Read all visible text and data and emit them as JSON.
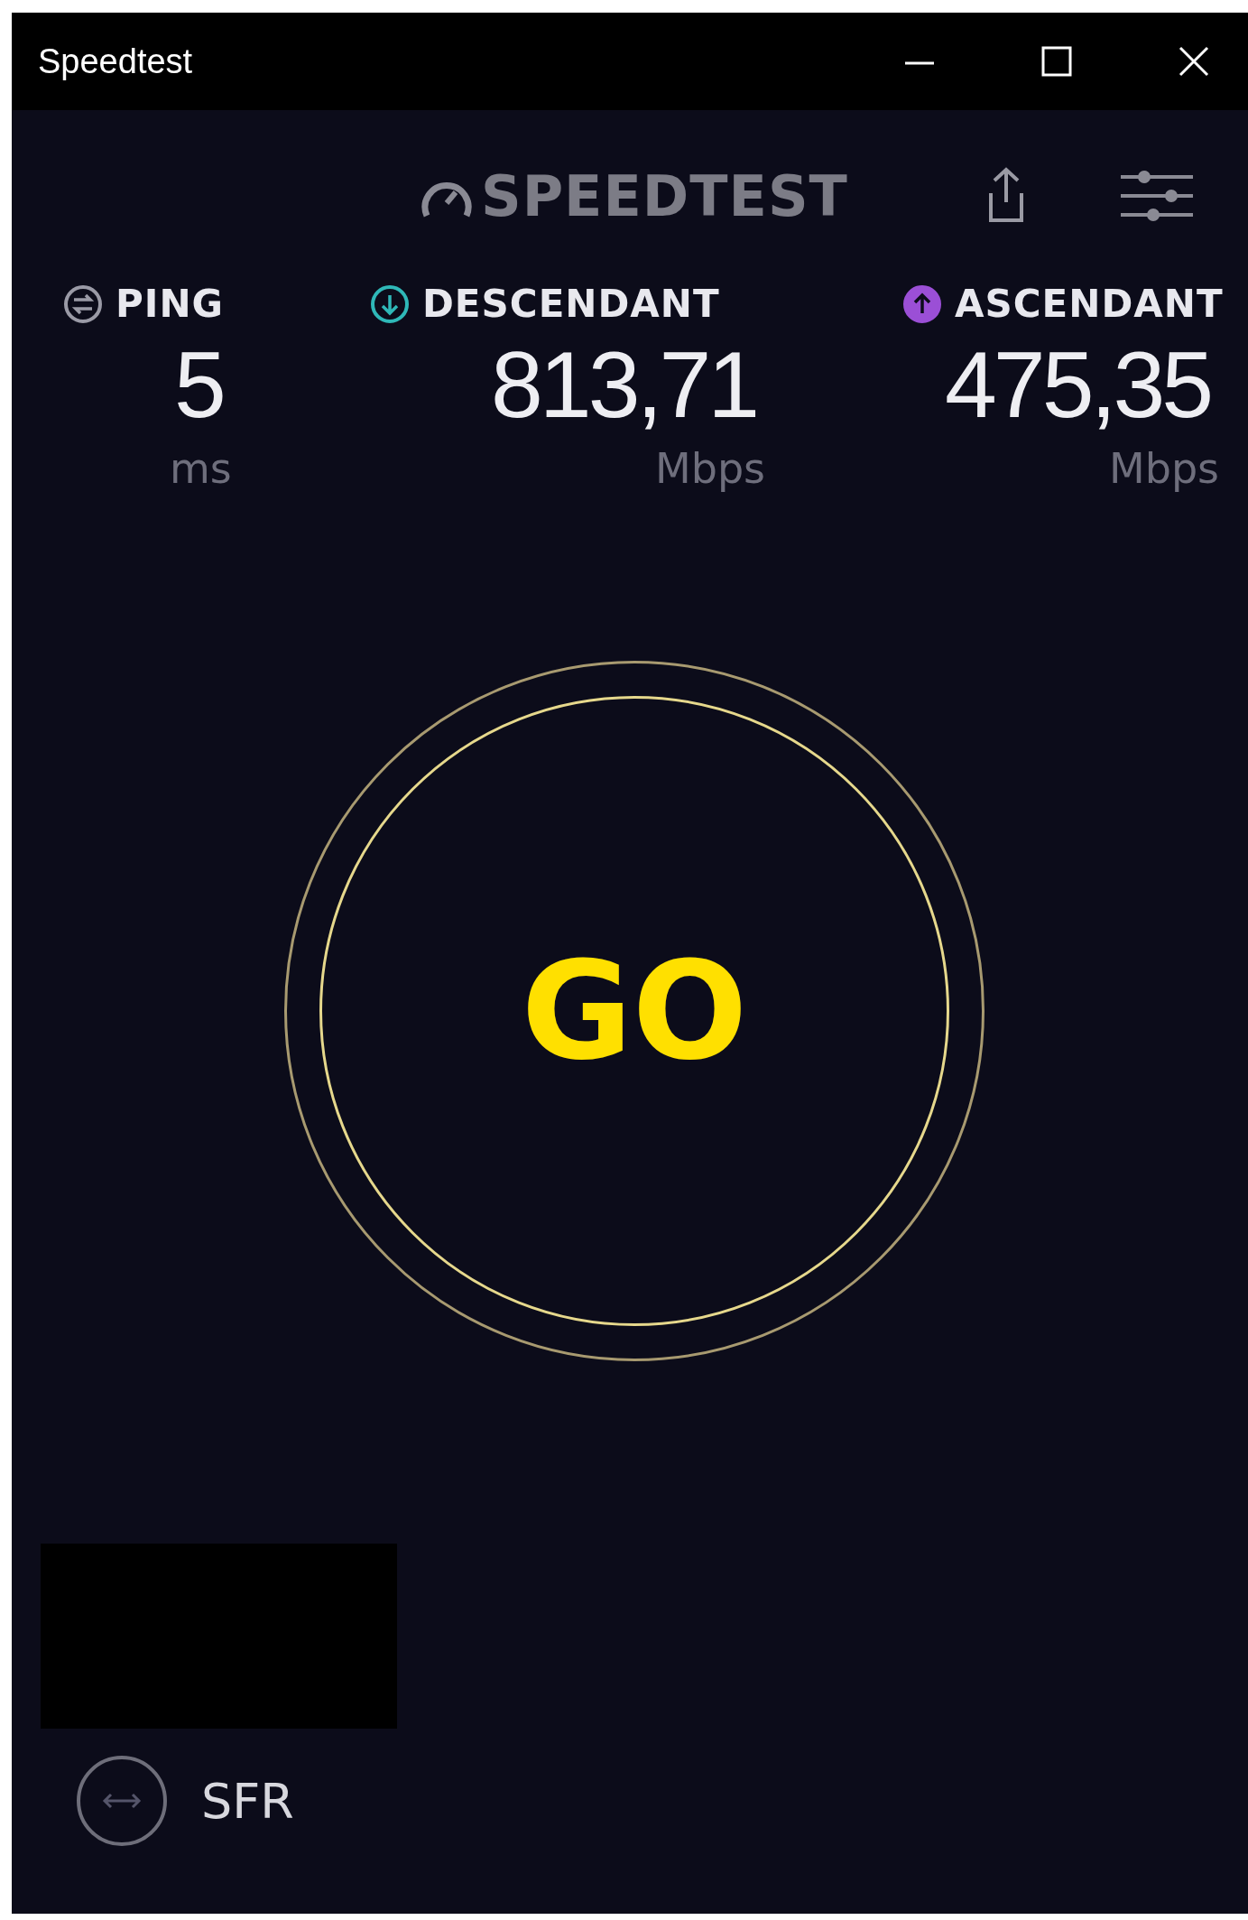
{
  "window": {
    "title": "Speedtest"
  },
  "header": {
    "logo": "SPEEDTEST"
  },
  "stats": [
    {
      "kind": "ping",
      "label": "PING",
      "value": "5",
      "unit": "ms",
      "color": "#9a9aa6"
    },
    {
      "kind": "download",
      "label": "DESCENDANT",
      "value": "813,71",
      "unit": "Mbps",
      "color": "#2fb8b8"
    },
    {
      "kind": "upload",
      "label": "ASCENDANT",
      "value": "475,35",
      "unit": "Mbps",
      "color": "#9b4fd6"
    }
  ],
  "go_button": {
    "label": "GO"
  },
  "provider": {
    "name": "SFR"
  }
}
